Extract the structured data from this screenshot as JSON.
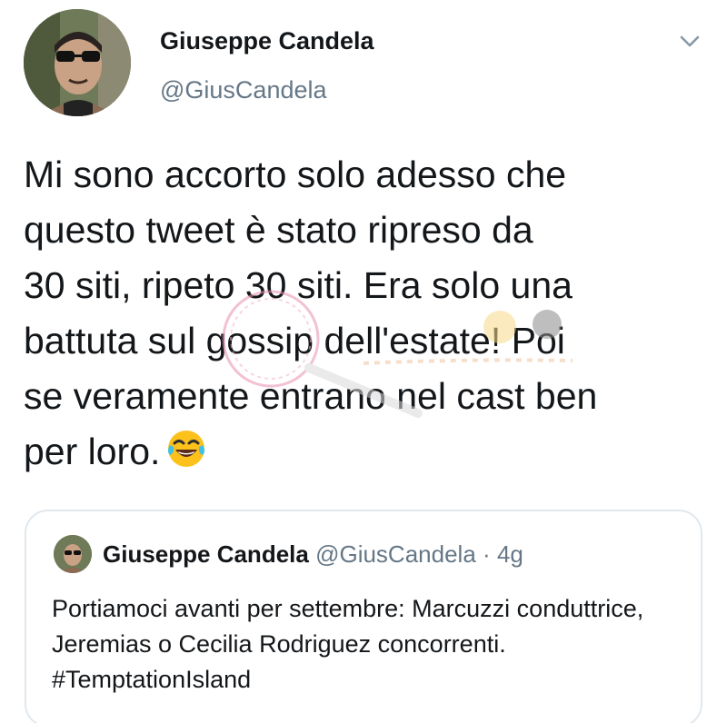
{
  "tweet": {
    "author_name": "Giuseppe Candela",
    "author_handle": "@GiusCandela",
    "text": "Mi sono accorto solo adesso che\nquesto tweet è stato ripreso da\n30 siti, ripeto 30 siti. Era solo una\nbattuta sul gossip dell'estate! Poi\nse veramente entrano nel cast ben\nper loro.",
    "emoji": "face-with-tears-of-joy"
  },
  "quoted_tweet": {
    "author_name": "Giuseppe Candela",
    "author_handle": "@GiusCandela",
    "separator": "·",
    "age": "4g",
    "text": "Portiamoci avanti per settembre: Marcuzzi conduttrice, Jeremias o Cecilia Rodriguez concorrenti. #TemptationIsland"
  },
  "colors": {
    "text_primary": "#14171a",
    "text_secondary": "#657786",
    "border": "#e1e8ed"
  },
  "icons": {
    "menu": "chevron-down-icon"
  }
}
